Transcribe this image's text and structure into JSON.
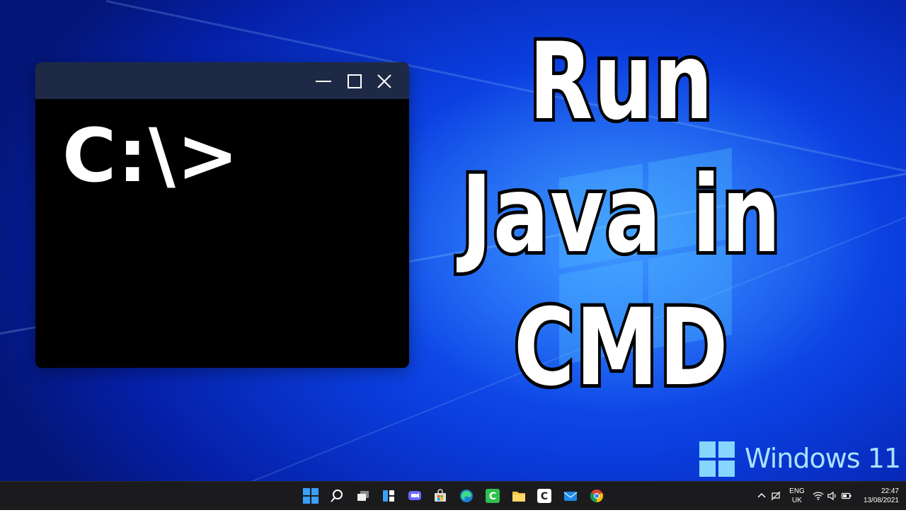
{
  "thumbnail": {
    "headline_lines": [
      "Run",
      "Java in",
      "CMD"
    ],
    "prompt_text": "C:\\>",
    "brand": "Windows 11"
  },
  "window_controls": {
    "minimize": "minimize-icon",
    "maximize": "maximize-icon",
    "close": "close-icon"
  },
  "taskbar": {
    "pinned": [
      {
        "name": "start-button",
        "icon": "windows-start-icon",
        "color": "#3aa0ff"
      },
      {
        "name": "search-button",
        "icon": "search-icon",
        "color": "#ffffff"
      },
      {
        "name": "task-view-button",
        "icon": "task-view-icon",
        "color": "#dddddd"
      },
      {
        "name": "widgets-button",
        "icon": "widgets-icon",
        "color": "#3aa0ff"
      },
      {
        "name": "chat-button",
        "icon": "teams-chat-icon",
        "color": "#6b68ff"
      },
      {
        "name": "store-button",
        "icon": "microsoft-store-icon",
        "color": "#dddddd"
      },
      {
        "name": "edge-button",
        "icon": "edge-icon",
        "color": "#1fb3a8"
      },
      {
        "name": "camtasia-button",
        "icon": "camtasia-icon",
        "color": "#2fbf4f"
      },
      {
        "name": "file-explorer-button",
        "icon": "folder-icon",
        "color": "#f6c344"
      },
      {
        "name": "camtasia-alt-button",
        "icon": "camtasia-icon",
        "color": "#ffffff"
      },
      {
        "name": "mail-button",
        "icon": "mail-icon",
        "color": "#1e88e5"
      },
      {
        "name": "chrome-button",
        "icon": "chrome-icon",
        "color": "#fbbc05"
      }
    ],
    "tray": {
      "language_line1": "ENG",
      "language_line2": "UK",
      "time": "22:47",
      "date": "13/08/2021",
      "icons": [
        "chevron-up-icon",
        "network-off-icon",
        "wifi-icon",
        "volume-icon",
        "battery-icon"
      ]
    }
  }
}
